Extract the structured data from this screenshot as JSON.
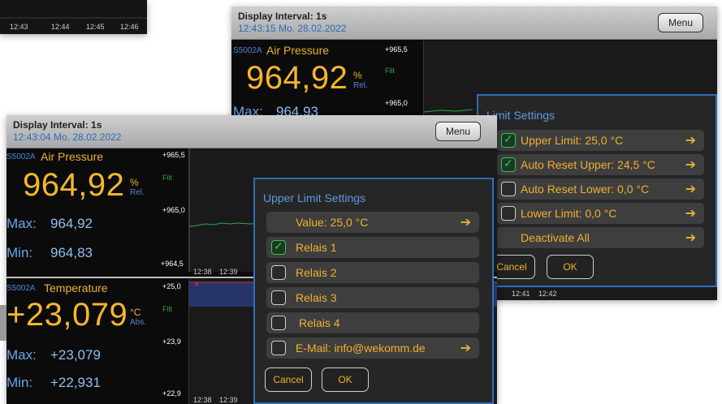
{
  "corner": {
    "ticks": [
      "12:43",
      "12:44",
      "12:45",
      "12:46"
    ]
  },
  "screen_back": {
    "header": {
      "interval": "Display Interval: 1s",
      "datetime": "12:43:15  Mo.  28.02.2022",
      "menu": "Menu"
    },
    "sensor": {
      "id": "S5002A",
      "name": "Air Pressure",
      "value": "964,92",
      "unit": "%",
      "unit_sub": "Rel.",
      "max_label": "Max:",
      "max_value": "964,93",
      "filt": "Filt",
      "scale_top": "+965,5",
      "scale_mid": "+965,0"
    },
    "graph_ticks": [
      "12:41",
      "12:42"
    ],
    "panel": {
      "title": "Limit Settings",
      "rows": [
        {
          "label": "Upper Limit: 25,0 °C",
          "checked": true,
          "arrow": "➔"
        },
        {
          "label": "Auto Reset Upper: 24,5 °C",
          "checked": true,
          "arrow": "➔"
        },
        {
          "label": "Auto Reset Lower: 0,0 °C",
          "checked": false,
          "arrow": "➔"
        },
        {
          "label": "Lower Limit: 0,0 °C",
          "checked": false,
          "arrow": "➔"
        },
        {
          "label": "Deactivate All",
          "arrow": "➔"
        }
      ],
      "cancel": "Cancel",
      "ok": "OK"
    }
  },
  "screen_front": {
    "header": {
      "interval": "Display Interval: 1s",
      "datetime": "12:43:04  Mo.  28.02.2022",
      "menu": "Menu"
    },
    "sensor1": {
      "id": "S5002A",
      "name": "Air Pressure",
      "value": "964,92",
      "unit": "%",
      "unit_sub": "Rel.",
      "max_label": "Max:",
      "max_value": "964,92",
      "min_label": "Min:",
      "min_value": "964,83",
      "filt": "Filt",
      "scale_top": "+965,5",
      "scale_mid": "+965,0",
      "scale_bot": "+964,5"
    },
    "sensor2": {
      "id": "S5002A",
      "name": "Temperature",
      "value": "+23,079",
      "unit": "°C",
      "unit_sub": "Abs.",
      "max_label": "Max:",
      "max_value": "+23,079",
      "min_label": "Min:",
      "min_value": "+22,931",
      "filt": "Filt",
      "scale_top": "+25,0",
      "scale_mid": "+23,9",
      "scale_bot": "+22,9"
    },
    "graph_ticks": [
      "12:38",
      "12:39"
    ],
    "panel": {
      "title": "Upper Limit Settings",
      "value_row": {
        "label": "Value: 25,0 °C",
        "arrow": "➔"
      },
      "relais": [
        {
          "label": "Relais 1",
          "checked": true
        },
        {
          "label": "Relais 2",
          "checked": false
        },
        {
          "label": "Relais 3",
          "checked": false
        },
        {
          "label": "Relais 4",
          "checked": false
        }
      ],
      "email_row": {
        "label": "E-Mail: info@wekomm.de",
        "checked": false,
        "arrow": "➔"
      },
      "cancel": "Cancel",
      "ok": "OK"
    }
  },
  "colors": {
    "accent_yellow": "#f5b62c",
    "accent_blue": "#4f86d6",
    "panel_border": "#2d6fb8",
    "check_green": "#3ec25a"
  }
}
